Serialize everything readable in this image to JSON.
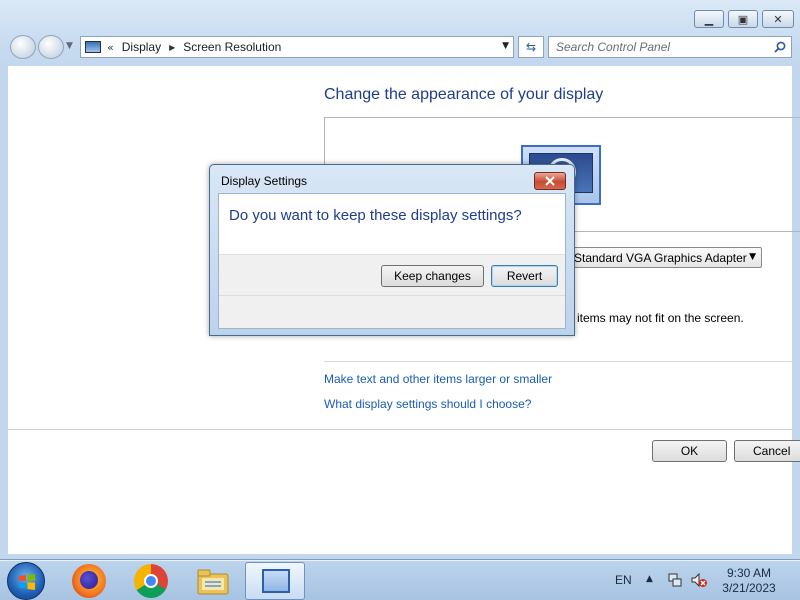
{
  "window": {
    "caption_buttons": {
      "minimize_icon": "minimize-icon",
      "maximize_icon": "maximize-icon",
      "close_icon": "close-icon"
    }
  },
  "address": {
    "chevron": "«",
    "crumbs": [
      "Display",
      "Screen Resolution"
    ],
    "search_placeholder": "Search Control Panel"
  },
  "main": {
    "heading": "Change the appearance of your display",
    "display_dropdown_value": "Standard VGA Graphics Adapter",
    "warning_text": "items may not fit on the screen.",
    "link_text_size": "Make text and other items larger or smaller",
    "link_settings_help": "What display settings should I choose?",
    "ok_label": "OK",
    "cancel_label": "Cancel"
  },
  "dialog": {
    "title": "Display Settings",
    "question": "Do you want to keep these display settings?",
    "keep_label": "Keep changes",
    "revert_label": "Revert"
  },
  "taskbar": {
    "pinned": [
      "Firefox",
      "Google Chrome",
      "Windows Explorer",
      "Control Panel"
    ],
    "language": "EN",
    "time": "9:30 AM",
    "date": "3/21/2023"
  },
  "colors": {
    "heading_blue": "#1e3d8f",
    "link_blue": "#1a5bb8",
    "close_red": "#c74a32"
  }
}
